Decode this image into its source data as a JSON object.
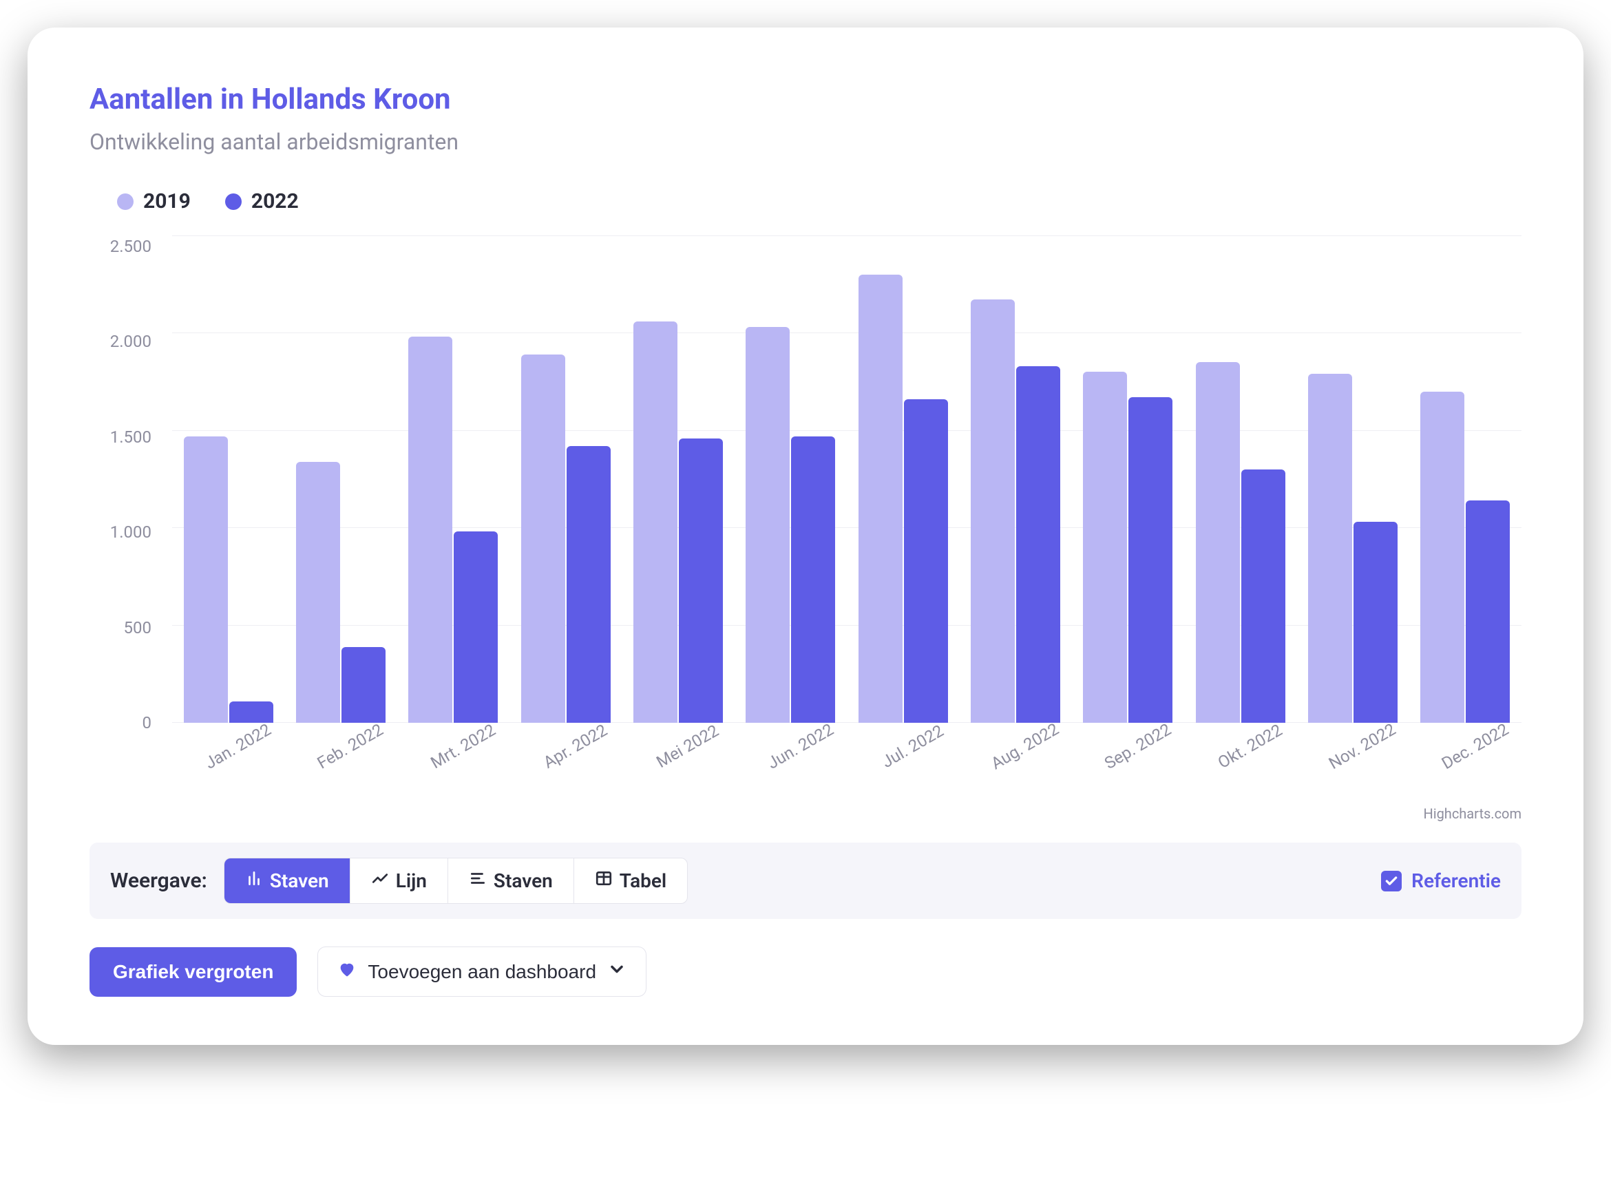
{
  "title": "Aantallen in Hollands Kroon",
  "subtitle": "Ontwikkeling aantal arbeidsmigranten",
  "credit": "Highcharts.com",
  "chart_data": {
    "type": "bar",
    "categories": [
      "Jan. 2022",
      "Feb. 2022",
      "Mrt. 2022",
      "Apr. 2022",
      "Mei 2022",
      "Jun. 2022",
      "Jul. 2022",
      "Aug. 2022",
      "Sep. 2022",
      "Okt. 2022",
      "Nov. 2022",
      "Dec. 2022"
    ],
    "series": [
      {
        "name": "2019",
        "color": "#B9B6F4",
        "values": [
          1470,
          1340,
          1980,
          1890,
          2060,
          2030,
          2300,
          2170,
          1800,
          1850,
          1790,
          1700
        ]
      },
      {
        "name": "2022",
        "color": "#5E5CE6",
        "values": [
          110,
          390,
          980,
          1420,
          1460,
          1470,
          1660,
          1830,
          1670,
          1300,
          1030,
          1140
        ]
      }
    ],
    "ylim": [
      0,
      2500
    ],
    "yticks": [
      "2.500",
      "2.000",
      "1.500",
      "1.000",
      "500",
      "0"
    ]
  },
  "toolbar": {
    "label": "Weergave:",
    "options": [
      {
        "label": "Staven",
        "icon": "bar-chart-icon",
        "active": true
      },
      {
        "label": "Lijn",
        "icon": "line-chart-icon",
        "active": false
      },
      {
        "label": "Staven",
        "icon": "hbar-chart-icon",
        "active": false
      },
      {
        "label": "Tabel",
        "icon": "table-icon",
        "active": false
      }
    ],
    "reference": {
      "label": "Referentie",
      "checked": true
    }
  },
  "actions": {
    "enlarge": "Grafiek vergroten",
    "add_dashboard": "Toevoegen aan dashboard"
  }
}
